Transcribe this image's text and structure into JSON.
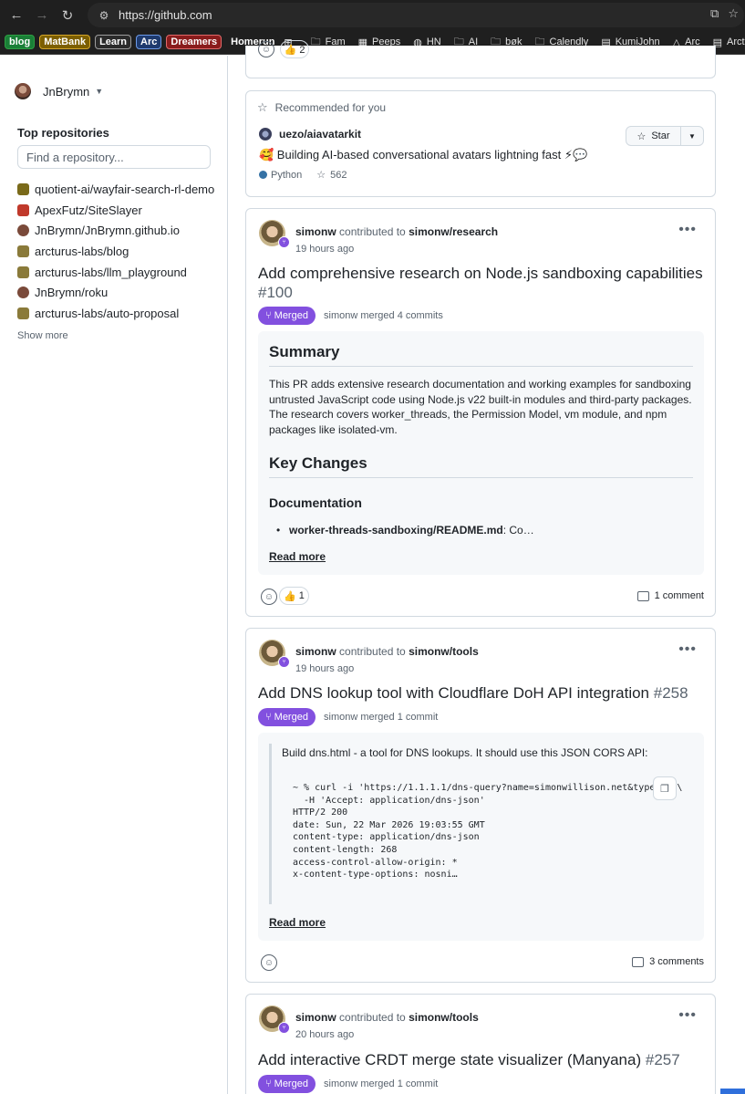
{
  "browser": {
    "url": "https://github.com",
    "bookmarks_chips": [
      {
        "label": "blog",
        "bg": "#1a7f37",
        "border": "#2ea043"
      },
      {
        "label": "MatBank",
        "bg": "#7d5f00",
        "border": "#d4a72c"
      },
      {
        "label": "Learn",
        "bg": "#2b2b2b",
        "border": "#9e9e9e"
      },
      {
        "label": "Arc",
        "bg": "#1e3a6e",
        "border": "#6e9be8"
      },
      {
        "label": "Dreamers",
        "bg": "#8a1c1c",
        "border": "#e06a6a"
      },
      {
        "label": "Homerun",
        "bg": "#1f1f1f",
        "border": "#1f1f1f"
      }
    ],
    "bookmarks": [
      {
        "label": "Fam",
        "icon": "folder-icon"
      },
      {
        "label": "Peeps",
        "icon": "sheet-icon"
      },
      {
        "label": "HN",
        "icon": "globe-icon"
      },
      {
        "label": "AI",
        "icon": "folder-icon"
      },
      {
        "label": "bøk",
        "icon": "folder-icon"
      },
      {
        "label": "Calendly",
        "icon": "folder-icon"
      },
      {
        "label": "KumiJohn",
        "icon": "doc-icon"
      },
      {
        "label": "Arc",
        "icon": "drive-icon"
      },
      {
        "label": "Arcturu",
        "icon": "doc-icon"
      }
    ]
  },
  "sidebar": {
    "user": "JnBrymn",
    "top_repos_title": "Top repositories",
    "find_placeholder": "Find a repository...",
    "repos": [
      {
        "name": "quotient-ai/wayfair-search-rl-demo",
        "color": "#7a6a1a"
      },
      {
        "name": "ApexFutz/SiteSlayer",
        "color": "#c0392b"
      },
      {
        "name": "JnBrymn/JnBrymn.github.io",
        "color": "#7a4a3a"
      },
      {
        "name": "arcturus-labs/blog",
        "color": "#8a7a3a"
      },
      {
        "name": "arcturus-labs/llm_playground",
        "color": "#8a7a3a"
      },
      {
        "name": "JnBrymn/roku",
        "color": "#7a4a3a"
      },
      {
        "name": "arcturus-labs/auto-proposal",
        "color": "#8a7a3a"
      }
    ],
    "show_more": "Show more"
  },
  "feed": {
    "partial_card": {
      "reaction": "👍 2"
    },
    "recommended": {
      "title": "Recommended for you",
      "repo": "uezo/aiavatarkit",
      "description": "🥰 Building AI-based conversational avatars lightning fast ⚡💬",
      "language": "Python",
      "stars": "562",
      "star_label": "Star"
    },
    "card1": {
      "author": "simonw",
      "contributed": "contributed to",
      "repo": "simonw/research",
      "time": "19 hours ago",
      "title": "Add comprehensive research on Node.js sandboxing capabilities",
      "number": "#100",
      "status": "Merged",
      "merge_meta": "simonw merged 4 commits",
      "h_summary": "Summary",
      "p1": "This PR adds extensive research documentation and working examples for sandboxing un­trusted JavaScript code using Node.js v22 built-in modules and third-party packages. The research covers worker_threads, the Permission Model, vm module, and npm packages like isolated-vm.",
      "h_key": "Key Changes",
      "h_docs": "Documentation",
      "li1_bold": "worker-threads-sandboxing/README.md",
      "li1_rest": ": Co…",
      "read_more": "Read more",
      "reaction": "1",
      "comments": "1 comment"
    },
    "card2": {
      "author": "simonw",
      "contributed": "contributed to",
      "repo": "simonw/tools",
      "time": "19 hours ago",
      "title": "Add DNS lookup tool with Cloudflare DoH API integration",
      "number": "#258",
      "status": "Merged",
      "merge_meta": "simonw merged 1 commit",
      "quote": "Build dns.html - a tool for DNS lookups. It should use this JSON CORS API:",
      "code": "~ % curl -i 'https://1.1.1.1/dns-query?name=simonwillison.net&type=A' \\\n  -H 'Accept: application/dns-json'\nHTTP/2 200\ndate: Sun, 22 Mar 2026 19:03:55 GMT\ncontent-type: application/dns-json\ncontent-length: 268\naccess-control-allow-origin: *\nx-content-type-options: nosni…",
      "read_more": "Read more",
      "comments": "3 comments"
    },
    "card3": {
      "author": "simonw",
      "contributed": "contributed to",
      "repo": "simonw/tools",
      "time": "20 hours ago",
      "title": "Add interactive CRDT merge state visualizer (Manyana)",
      "number": "#257",
      "status": "Merged",
      "merge_meta": "simonw merged 1 commit"
    }
  }
}
